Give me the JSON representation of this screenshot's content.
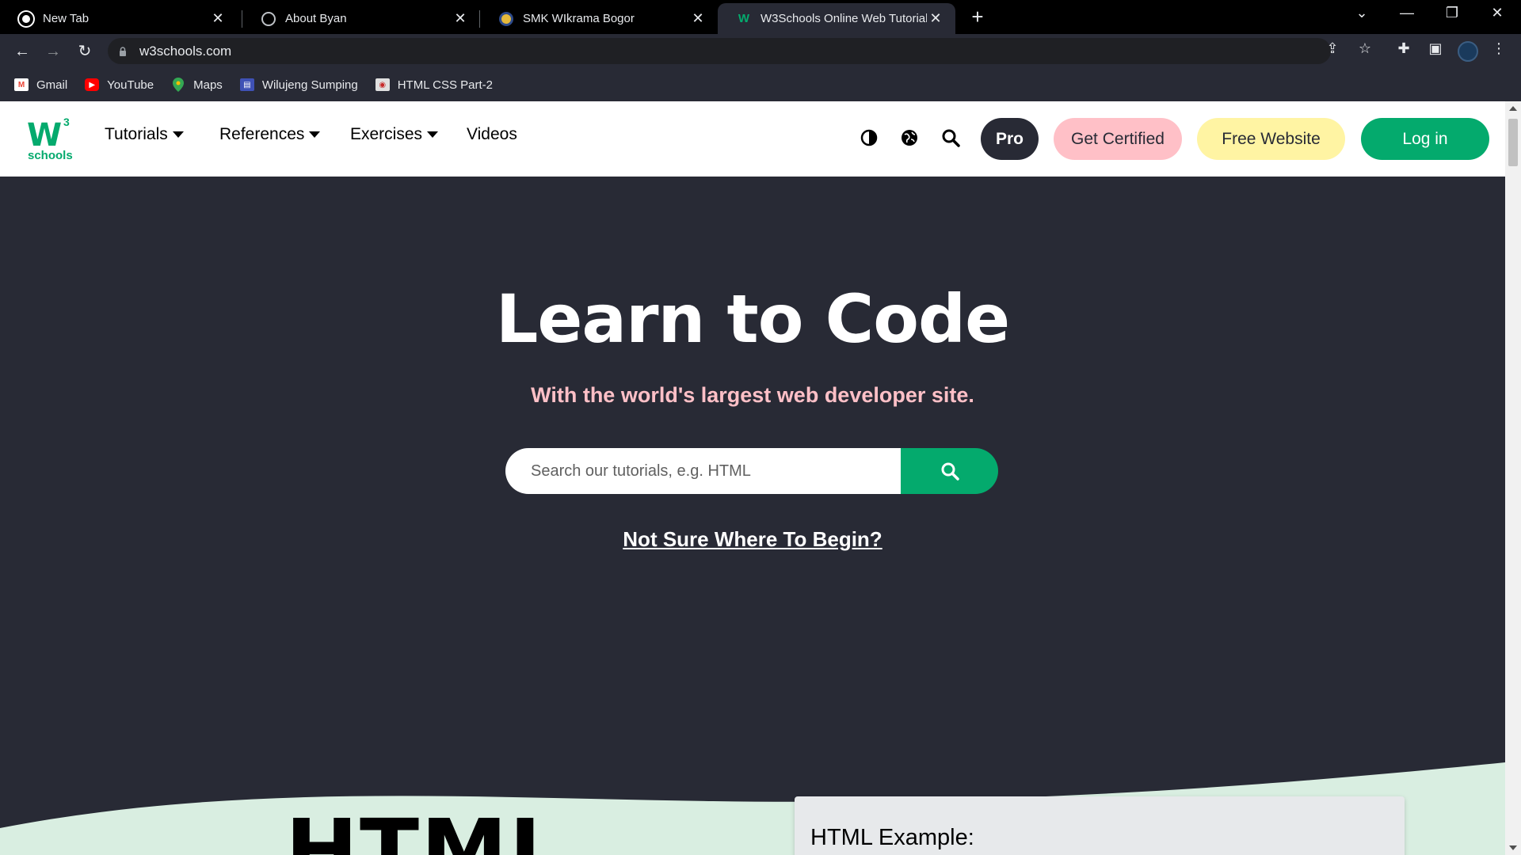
{
  "browser": {
    "tabs": [
      {
        "title": "New Tab",
        "favicon": "chrome-icon"
      },
      {
        "title": "About Byan",
        "favicon": "globe-icon"
      },
      {
        "title": "SMK WIkrama Bogor",
        "favicon": "school-emblem-icon"
      },
      {
        "title": "W3Schools Online Web Tutorials",
        "favicon": "w3schools-icon"
      }
    ],
    "active_tab": 3,
    "url": "w3schools.com",
    "bookmarks": [
      {
        "label": "Gmail",
        "icon": "gmail-icon",
        "color": "#ea4335"
      },
      {
        "label": "YouTube",
        "icon": "youtube-icon",
        "color": "#ff0000"
      },
      {
        "label": "Maps",
        "icon": "maps-icon",
        "color": "#34a853"
      },
      {
        "label": "Wilujeng Sumping",
        "icon": "site-icon",
        "color": "#3f51b5"
      },
      {
        "label": "HTML CSS Part-2",
        "icon": "site-icon",
        "color": "#e0e0e0"
      }
    ]
  },
  "site": {
    "logo": {
      "mark": "W",
      "sup": "3",
      "word": "schools"
    },
    "nav": {
      "tutorials": "Tutorials",
      "references": "References",
      "exercises": "Exercises",
      "videos": "Videos"
    },
    "buttons": {
      "pro": "Pro",
      "certified": "Get Certified",
      "free_website": "Free Website",
      "login": "Log in"
    },
    "hero": {
      "title": "Learn to Code",
      "subtitle": "With the world's largest web developer site.",
      "search_placeholder": "Search our tutorials, e.g. HTML",
      "begin_link": "Not Sure Where To Begin?"
    },
    "section": {
      "heading": "HTML",
      "example_title": "HTML Example:"
    },
    "colors": {
      "dark": "#282a35",
      "green": "#04aa6d",
      "pink": "#ffc0c7",
      "yellow": "#fff4a3",
      "mint": "#d9eee1"
    }
  }
}
